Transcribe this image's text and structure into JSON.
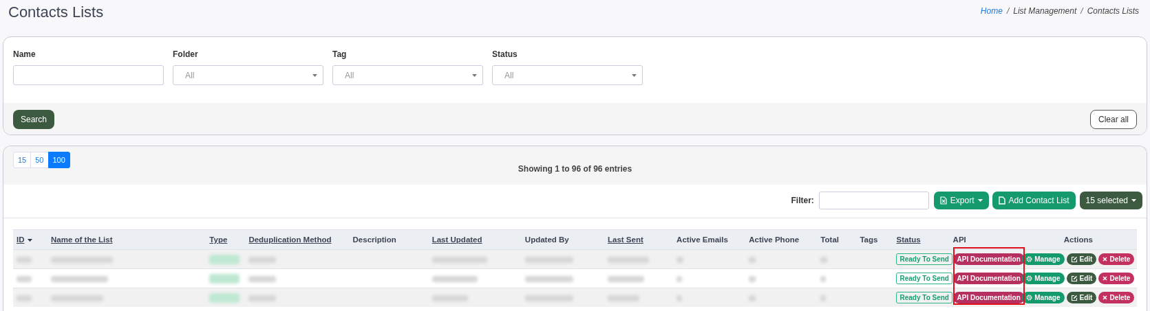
{
  "page": {
    "title": "Contacts Lists"
  },
  "breadcrumb": [
    {
      "label": "Home",
      "link": true
    },
    {
      "separator": "/",
      "label": "List Management",
      "link": false
    },
    {
      "separator": "/",
      "label": "Contacts Lists",
      "link": false
    }
  ],
  "filters": [
    {
      "kind": "text",
      "label": "Name"
    },
    {
      "kind": "select",
      "label": "Folder",
      "value": "All"
    },
    {
      "kind": "select",
      "label": "Tag",
      "value": "All"
    },
    {
      "kind": "select",
      "label": "Status",
      "value": "All"
    }
  ],
  "search_button": "Search",
  "clear_button": "Clear all",
  "page_sizes": [
    {
      "label": "15",
      "selected": false
    },
    {
      "label": "50",
      "selected": false
    },
    {
      "label": "100",
      "selected": true
    }
  ],
  "summary": "Showing 1 to 96 of 96 entries",
  "filter_label": "Filter:",
  "toolbar": [
    {
      "kind": "export",
      "label": "Export"
    },
    {
      "kind": "add",
      "label": "Add Contact List"
    },
    {
      "kind": "selected",
      "label": "15 selected"
    }
  ],
  "columns": [
    {
      "label": "ID",
      "sortable": true,
      "sorted": true
    },
    {
      "label": "Name of the List",
      "sortable": true,
      "sorted": false
    },
    {
      "label": "Type",
      "sortable": true,
      "sorted": false
    },
    {
      "label": "Deduplication Method",
      "sortable": true,
      "sorted": false
    },
    {
      "label": "Description",
      "sortable": false
    },
    {
      "label": "Last Updated",
      "sortable": true,
      "sorted": false
    },
    {
      "label": "Updated By",
      "sortable": false
    },
    {
      "label": "Last Sent",
      "sortable": true,
      "sorted": false
    },
    {
      "label": "Active Emails",
      "sortable": false
    },
    {
      "label": "Active Phone",
      "sortable": false
    },
    {
      "label": "Total",
      "sortable": false
    },
    {
      "label": "Tags",
      "sortable": false
    },
    {
      "label": "Status",
      "sortable": true,
      "sorted": false
    },
    {
      "label": "API",
      "sortable": false
    },
    {
      "label": "Actions",
      "sortable": false
    }
  ],
  "rows": [
    {
      "cells": [
        {
          "kind": "redacted"
        },
        {
          "kind": "redacted"
        },
        {
          "kind": "redacted-tag"
        },
        {
          "kind": "redacted"
        },
        {
          "kind": "blank"
        },
        {
          "kind": "redacted"
        },
        {
          "kind": "redacted"
        },
        {
          "kind": "redacted"
        },
        {
          "kind": "redacted"
        },
        {
          "kind": "redacted"
        },
        {
          "kind": "redacted"
        },
        {
          "kind": "blank"
        },
        {
          "kind": "status",
          "label": "Ready To Send"
        },
        {
          "kind": "api",
          "label": "API Documentation"
        },
        {
          "kind": "actions",
          "actions": [
            {
              "kind": "manage",
              "label": "Manage"
            },
            {
              "kind": "edit",
              "label": "Edit"
            },
            {
              "kind": "delete",
              "label": "Delete"
            }
          ]
        }
      ]
    },
    {
      "cells": [
        {
          "kind": "redacted"
        },
        {
          "kind": "redacted"
        },
        {
          "kind": "redacted-tag"
        },
        {
          "kind": "redacted"
        },
        {
          "kind": "blank"
        },
        {
          "kind": "redacted"
        },
        {
          "kind": "redacted"
        },
        {
          "kind": "redacted"
        },
        {
          "kind": "redacted"
        },
        {
          "kind": "redacted"
        },
        {
          "kind": "redacted"
        },
        {
          "kind": "blank"
        },
        {
          "kind": "status",
          "label": "Ready To Send"
        },
        {
          "kind": "api",
          "label": "API Documentation"
        },
        {
          "kind": "actions",
          "actions": [
            {
              "kind": "manage",
              "label": "Manage"
            },
            {
              "kind": "edit",
              "label": "Edit"
            },
            {
              "kind": "delete",
              "label": "Delete"
            }
          ]
        }
      ]
    },
    {
      "cells": [
        {
          "kind": "redacted"
        },
        {
          "kind": "redacted"
        },
        {
          "kind": "redacted-tag"
        },
        {
          "kind": "redacted"
        },
        {
          "kind": "blank"
        },
        {
          "kind": "redacted"
        },
        {
          "kind": "redacted"
        },
        {
          "kind": "redacted"
        },
        {
          "kind": "redacted"
        },
        {
          "kind": "redacted"
        },
        {
          "kind": "redacted"
        },
        {
          "kind": "blank"
        },
        {
          "kind": "status",
          "label": "Ready To Send"
        },
        {
          "kind": "api",
          "label": "API Documentation"
        },
        {
          "kind": "actions",
          "actions": [
            {
              "kind": "manage",
              "label": "Manage"
            },
            {
              "kind": "edit",
              "label": "Edit"
            },
            {
              "kind": "delete",
              "label": "Delete"
            }
          ]
        }
      ]
    }
  ],
  "api_highlight": true
}
